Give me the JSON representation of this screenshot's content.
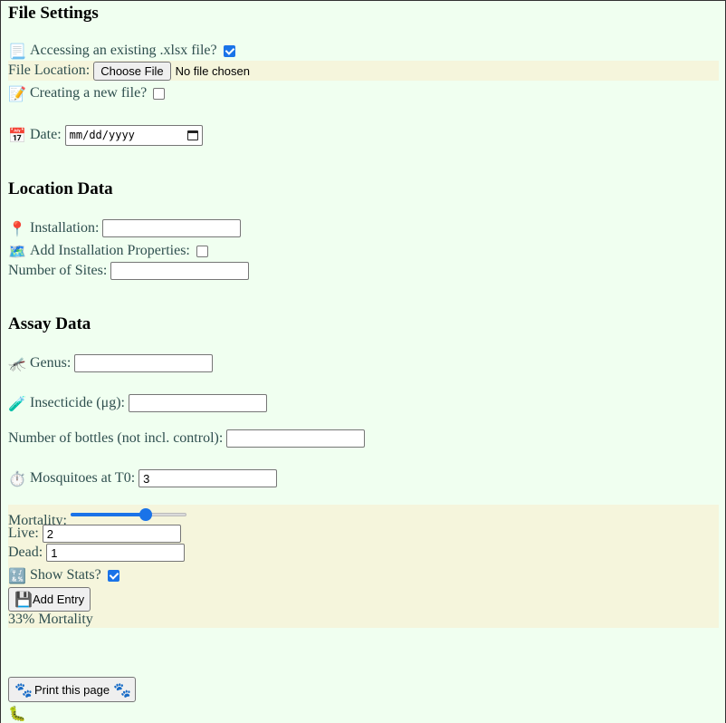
{
  "file_settings": {
    "heading": "File Settings",
    "access_existing_label": "Accessing an existing .xlsx file?",
    "access_existing_checked": true,
    "file_location_label": "File Location:",
    "choose_file_button": "Choose File",
    "no_file_text": "No file chosen",
    "create_new_label": "Creating a new file?",
    "create_new_checked": false,
    "date_label": "Date:",
    "date_placeholder": "mm/dd/yyyy"
  },
  "location_data": {
    "heading": "Location Data",
    "installation_label": "Installation:",
    "installation_value": "",
    "add_props_label": "Add Installation Properties:",
    "add_props_checked": false,
    "num_sites_label": "Number of Sites:",
    "num_sites_value": ""
  },
  "assay_data": {
    "heading": "Assay Data",
    "genus_label": "Genus:",
    "genus_value": "",
    "insecticide_label": "Insecticide (μg):",
    "insecticide_value": "",
    "bottles_label": "Number of bottles (not incl. control):",
    "bottles_value": "",
    "mosquitoes_label": "Mosquitoes at T0:",
    "mosquitoes_value": "3"
  },
  "mortality": {
    "slider_label": "Mortality:",
    "slider_fraction": 0.65,
    "live_label": "Live:",
    "live_value": "2",
    "dead_label": "Dead:",
    "dead_value": "1",
    "show_stats_label": "Show Stats?",
    "show_stats_checked": true,
    "add_entry_button": "Add Entry",
    "result_text": "33% Mortality"
  },
  "print_button": "Print this page",
  "icons": {
    "scroll": "📃",
    "file_location_icon": "",
    "memo": "📝",
    "calendar": "📅",
    "pin": "📍",
    "map": "🗺️",
    "mosquito": "🦟",
    "test_tube": "🧪",
    "stopwatch": "⏱️",
    "symbols": "🔣",
    "floppy": "💾",
    "paws": "🐾",
    "caterpillar": "🐛"
  }
}
